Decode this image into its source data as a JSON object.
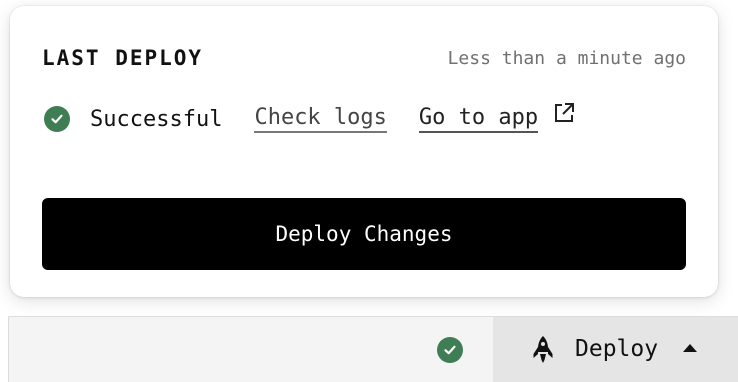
{
  "popover": {
    "title": "LAST DEPLOY",
    "time": "Less than a minute ago",
    "status": {
      "icon": "check-circle-icon",
      "label": "Successful",
      "color": "#3f7d55"
    },
    "check_logs_label": "Check logs",
    "go_to_app_label": "Go to app",
    "external_link_icon": "external-link-icon",
    "deploy_button_label": "Deploy Changes"
  },
  "statusbar": {
    "status_icon": "check-circle-icon",
    "deploy_icon": "rocket-icon",
    "deploy_label": "Deploy",
    "deploy_caret_icon": "caret-up-icon"
  },
  "colors": {
    "success": "#3f7d55",
    "button_bg": "#000000",
    "button_text": "#ffffff",
    "statusbar_bg": "#f4f4f4",
    "deploy_bg": "#e5e5e5"
  }
}
